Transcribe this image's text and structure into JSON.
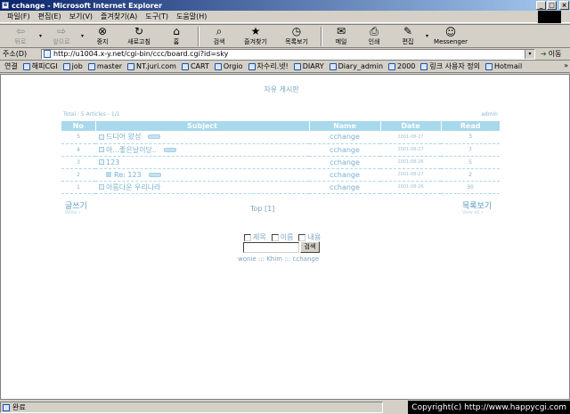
{
  "window": {
    "title": "cchange - Microsoft Internet Explorer"
  },
  "menu": [
    "파일(F)",
    "편집(E)",
    "보기(V)",
    "즐겨찾기(A)",
    "도구(T)",
    "도움말(H)"
  ],
  "toolbar": {
    "back": "뒤로",
    "forward": "앞으로",
    "stop": "중지",
    "refresh": "새로고침",
    "home": "홈",
    "search": "검색",
    "favorites": "즐겨찾기",
    "history": "목록보기",
    "mail": "메일",
    "print": "인쇄",
    "edit": "편집",
    "messenger": "Messenger"
  },
  "address": {
    "label": "주소(D)",
    "url": "http://u1004.x-y.net/cgi-bin/ccc/board.cgi?id=sky",
    "go": "이동"
  },
  "links": {
    "title": "연결",
    "items": [
      "해피CGI",
      "job",
      "master",
      "NT.juri.com",
      "CART",
      "Orgio",
      "차수리.넷!",
      "DIARY",
      "Diary_admin",
      "2000",
      "링크 사용자 정의",
      "Hotmail"
    ]
  },
  "board": {
    "title": "자유 게시판",
    "total": "Total : 5 Articles - 1/1",
    "admin": "admin",
    "columns": [
      "No",
      "Subject",
      "Name",
      "Date",
      "Read"
    ],
    "rows": [
      {
        "no": "5",
        "subject": "드디어 왔성",
        "name": "cchange",
        "date": "2001-08-27",
        "read": "3"
      },
      {
        "no": "4",
        "subject": "아...좋은날이당..",
        "name": "cchange",
        "date": "2001-08-27",
        "read": "7"
      },
      {
        "no": "3",
        "subject": "123",
        "name": "cchange",
        "date": "2001-08-26",
        "read": "5"
      },
      {
        "no": "2",
        "subject": "Re: 123",
        "name": "cchange",
        "date": "2001-08-27",
        "read": "2"
      },
      {
        "no": "1",
        "subject": "아름다운 우리나라",
        "name": "cchange",
        "date": "2001-08-26",
        "read": "30"
      }
    ],
    "write": "글쓰기",
    "write_sub": "Write »",
    "list": "목록보기",
    "list_sub": "View all »",
    "page_nav": "Top [1]",
    "search": {
      "opt_title": "제목",
      "opt_name": "이름",
      "opt_content": "내용",
      "button": "검색"
    },
    "credits": "wonie ::: Khim ::: cchange"
  },
  "status": {
    "text": "완료",
    "copyright": "Copyright(c) http://www.happycgi.com"
  }
}
